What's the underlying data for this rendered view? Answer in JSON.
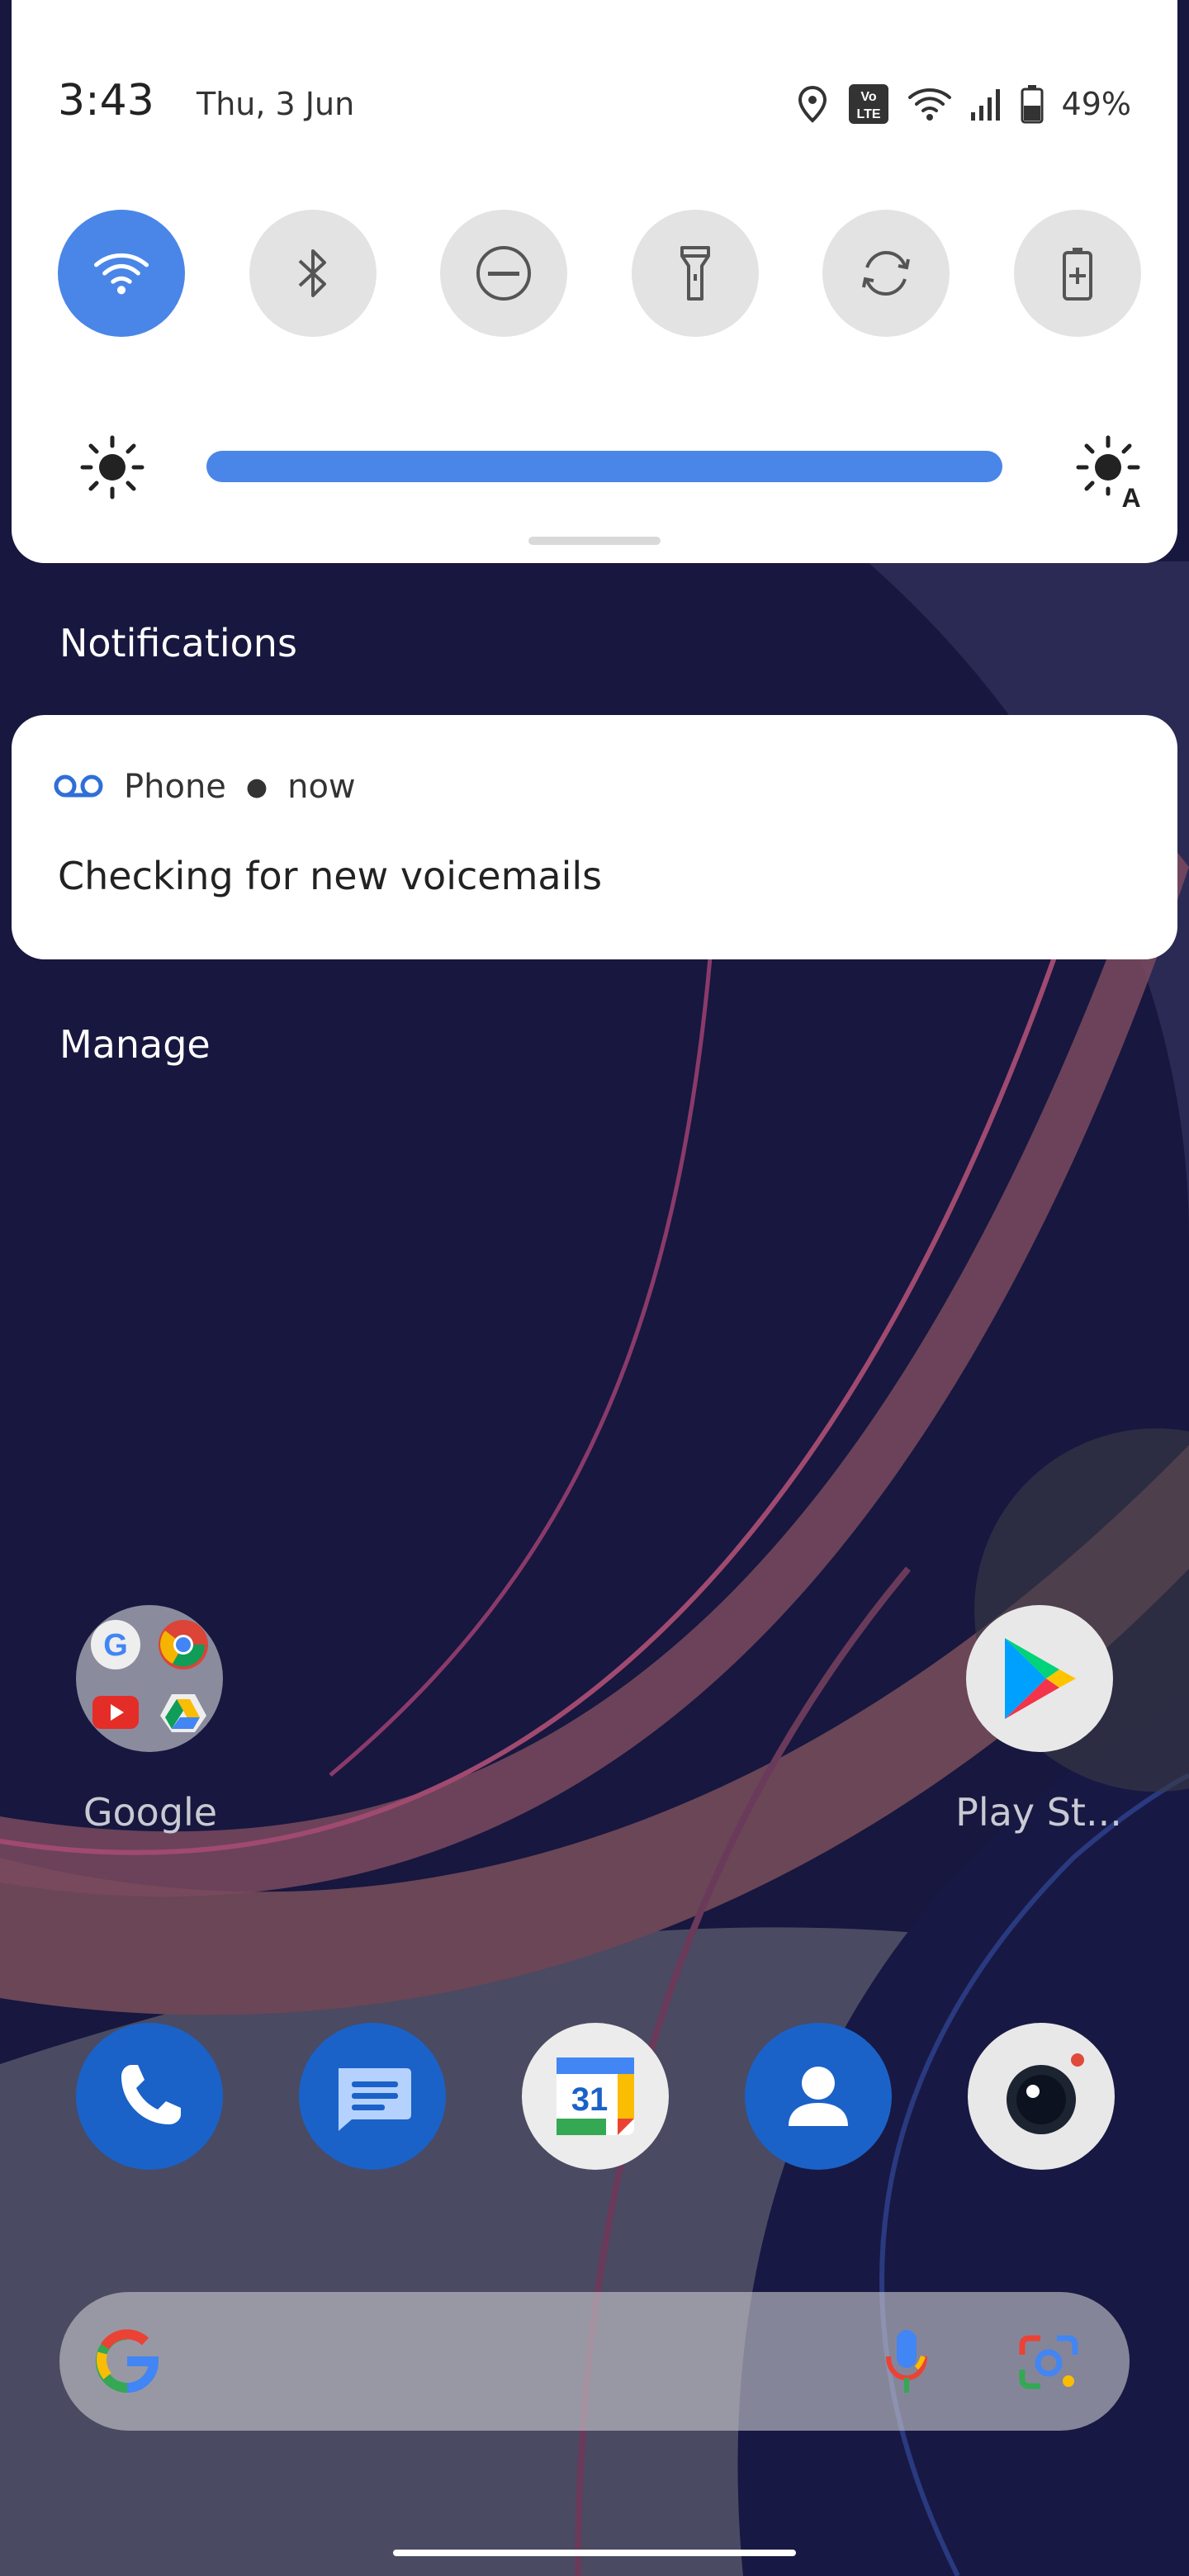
{
  "status_bar": {
    "time": "3:43",
    "date": "Thu, 3 Jun",
    "volte_badge": "Vo LTE",
    "battery_percent": "49%",
    "icons": [
      "location-icon",
      "volte-icon",
      "wifi-icon",
      "signal-icon",
      "battery-icon"
    ]
  },
  "quick_settings": {
    "tiles": [
      {
        "name": "wifi",
        "icon": "wifi-icon",
        "active": true
      },
      {
        "name": "bluetooth",
        "icon": "bluetooth-icon",
        "active": false
      },
      {
        "name": "do-not-disturb",
        "icon": "dnd-icon",
        "active": false
      },
      {
        "name": "flashlight",
        "icon": "flashlight-icon",
        "active": false
      },
      {
        "name": "auto-rotate",
        "icon": "rotate-icon",
        "active": false
      },
      {
        "name": "battery-saver",
        "icon": "battery-saver-icon",
        "active": false
      }
    ],
    "brightness_level": 1.0,
    "brightness_auto_icon_letter": "A"
  },
  "notifications": {
    "header": "Notifications",
    "items": [
      {
        "app": "Phone",
        "time": "now",
        "text": "Checking for new voicemails",
        "icon": "voicemail-icon"
      }
    ],
    "manage_label": "Manage"
  },
  "home": {
    "folder_label": "Google",
    "play_store_label": "Play St...",
    "calendar_day": "31",
    "dock": [
      "phone-icon",
      "messages-icon",
      "calendar-icon",
      "contacts-icon",
      "camera-icon"
    ]
  },
  "colors": {
    "accent": "#4a86e8",
    "panel": "#ffffff",
    "tile_off": "#e3e3e3",
    "wallpaper_dark": "#16163f"
  }
}
